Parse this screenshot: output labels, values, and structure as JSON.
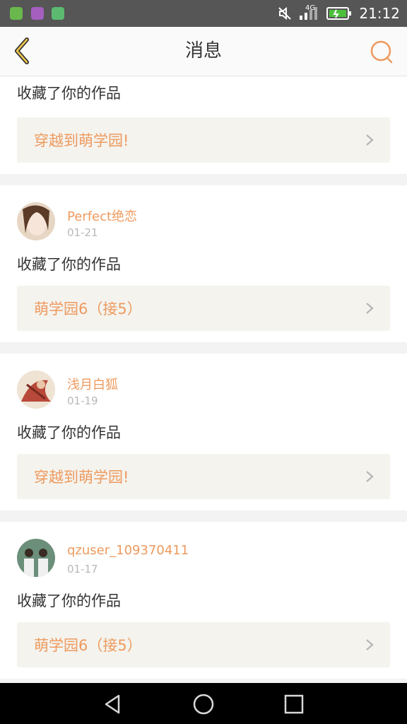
{
  "status_bar": {
    "network": "4G",
    "time": "21:12",
    "app_icons": [
      "notification-app-icon",
      "gallery-app-icon",
      "wechat-app-icon"
    ]
  },
  "header": {
    "title": "消息",
    "back_icon": "chevron-left-icon",
    "search_icon": "search-icon",
    "accent_color": "#ee9a5e"
  },
  "notifications": [
    {
      "action": "收藏了你的作品",
      "work": "穿越到萌学园!"
    },
    {
      "user": "Perfect绝恋",
      "date": "01-21",
      "action": "收藏了你的作品",
      "work": "萌学园6（接5）"
    },
    {
      "user": "浅月白狐",
      "date": "01-19",
      "action": "收藏了你的作品",
      "work": "穿越到萌学园!"
    },
    {
      "user": "qzuser_109370411",
      "date": "01-17",
      "action": "收藏了你的作品",
      "work": "萌学园6（接5）"
    }
  ],
  "nav": {
    "back": "nav-back-icon",
    "home": "nav-home-icon",
    "recents": "nav-recents-icon"
  }
}
